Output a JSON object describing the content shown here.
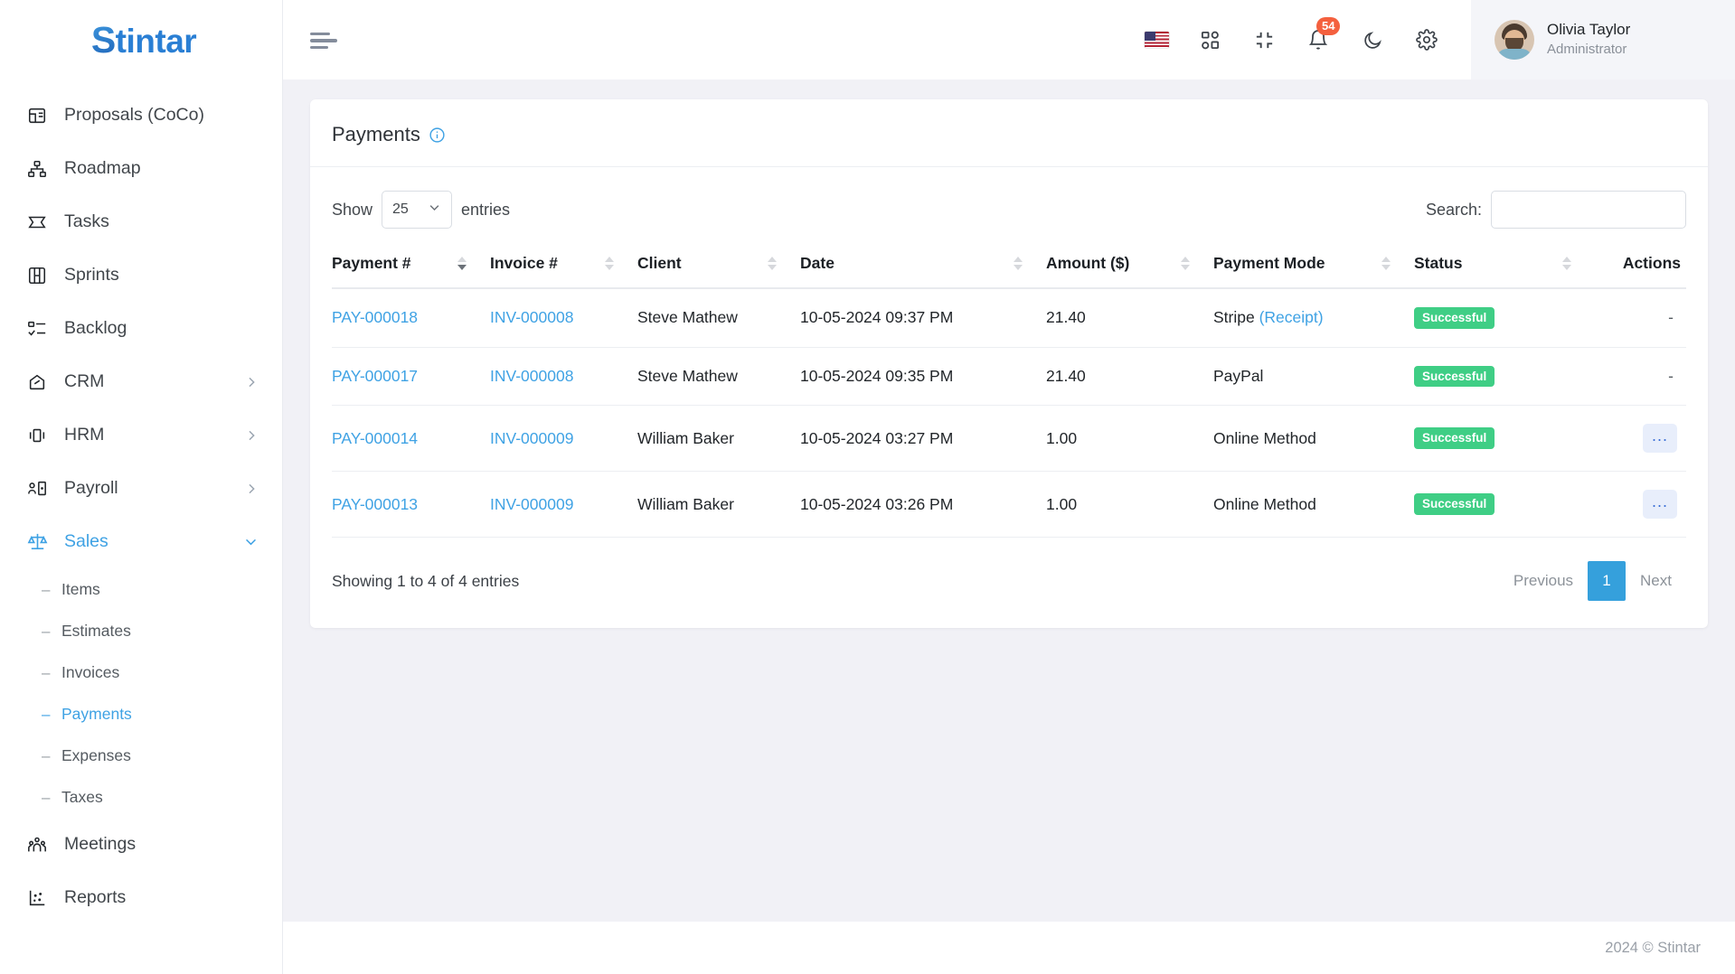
{
  "brand": {
    "letter": "S",
    "rest": "tintar"
  },
  "topbar": {
    "menu_toggle": "hamburger-menu",
    "icons": [
      "flag-usa-icon",
      "apps-grid-icon",
      "collapse-icon",
      "bell-icon",
      "moon-icon",
      "gear-icon"
    ],
    "notification_count": "54",
    "user": {
      "name": "Olivia Taylor",
      "role": "Administrator"
    }
  },
  "sidebar": {
    "items": [
      {
        "label": "Proposals (CoCo)",
        "icon": "proposal-icon",
        "chevron": "",
        "active": false
      },
      {
        "label": "Roadmap",
        "icon": "roadmap-icon",
        "chevron": "",
        "active": false
      },
      {
        "label": "Tasks",
        "icon": "tasks-icon",
        "chevron": "",
        "active": false
      },
      {
        "label": "Sprints",
        "icon": "sprints-icon",
        "chevron": "",
        "active": false
      },
      {
        "label": "Backlog",
        "icon": "backlog-icon",
        "chevron": "",
        "active": false
      },
      {
        "label": "CRM",
        "icon": "crm-icon",
        "chevron": "chevron-right-icon",
        "active": false
      },
      {
        "label": "HRM",
        "icon": "hrm-icon",
        "chevron": "chevron-right-icon",
        "active": false
      },
      {
        "label": "Payroll",
        "icon": "payroll-icon",
        "chevron": "chevron-right-icon",
        "active": false
      },
      {
        "label": "Sales",
        "icon": "sales-icon",
        "chevron": "chevron-down-icon",
        "active": true
      }
    ],
    "sales_subitems": [
      {
        "label": "Items",
        "active": false
      },
      {
        "label": "Estimates",
        "active": false
      },
      {
        "label": "Invoices",
        "active": false
      },
      {
        "label": "Payments",
        "active": true
      },
      {
        "label": "Expenses",
        "active": false
      },
      {
        "label": "Taxes",
        "active": false
      }
    ],
    "bottom_items": [
      {
        "label": "Meetings",
        "icon": "meetings-icon"
      },
      {
        "label": "Reports",
        "icon": "reports-icon"
      }
    ]
  },
  "page": {
    "title": "Payments",
    "info_icon": "info-circle-icon"
  },
  "table_tools": {
    "show_label": "Show",
    "entries_label": "entries",
    "page_size": "25",
    "search_label": "Search:",
    "search_value": "",
    "search_placeholder": ""
  },
  "table": {
    "columns": [
      {
        "label": "Payment #",
        "sorted": "asc"
      },
      {
        "label": "Invoice #",
        "sorted": ""
      },
      {
        "label": "Client",
        "sorted": ""
      },
      {
        "label": "Date",
        "sorted": ""
      },
      {
        "label": "Amount ($)",
        "sorted": ""
      },
      {
        "label": "Payment Mode",
        "sorted": ""
      },
      {
        "label": "Status",
        "sorted": ""
      },
      {
        "label": "Actions",
        "sorted": ""
      }
    ],
    "rows": [
      {
        "payment": "PAY-000018",
        "invoice": "INV-000008",
        "client": "Steve Mathew",
        "date": "10-05-2024 09:37 PM",
        "amount": "21.40",
        "mode": "Stripe",
        "mode_link": "(Receipt)",
        "status": "Successful",
        "action": "-"
      },
      {
        "payment": "PAY-000017",
        "invoice": "INV-000008",
        "client": "Steve Mathew",
        "date": "10-05-2024 09:35 PM",
        "amount": "21.40",
        "mode": "PayPal",
        "mode_link": "",
        "status": "Successful",
        "action": "-"
      },
      {
        "payment": "PAY-000014",
        "invoice": "INV-000009",
        "client": "William Baker",
        "date": "10-05-2024 03:27 PM",
        "amount": "1.00",
        "mode": "Online Method",
        "mode_link": "",
        "status": "Successful",
        "action": "..."
      },
      {
        "payment": "PAY-000013",
        "invoice": "INV-000009",
        "client": "William Baker",
        "date": "10-05-2024 03:26 PM",
        "amount": "1.00",
        "mode": "Online Method",
        "mode_link": "",
        "status": "Successful",
        "action": "..."
      }
    ]
  },
  "pagination": {
    "info": "Showing 1 to 4 of 4 entries",
    "previous": "Previous",
    "current_page": "1",
    "next": "Next"
  },
  "footer": {
    "text": "2024 © Stintar"
  },
  "colors": {
    "accent": "#3fa2e4",
    "success": "#3fce85",
    "pager_active": "#35a0dc",
    "badge": "#f4603e",
    "body_bg": "#f1f1f6"
  }
}
